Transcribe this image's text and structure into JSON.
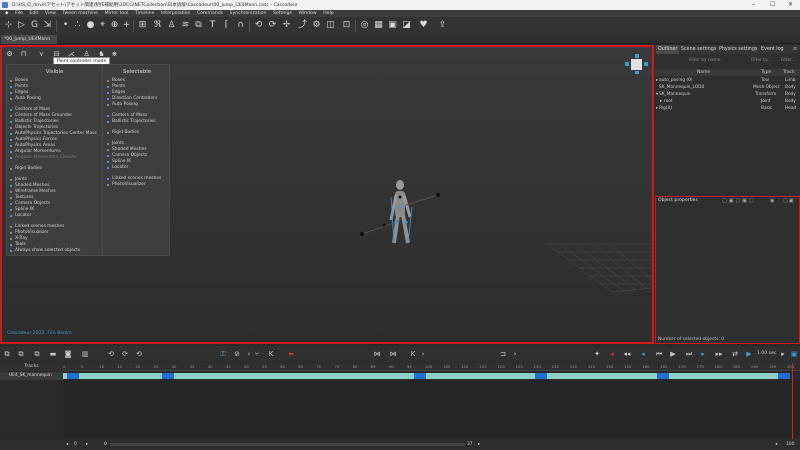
{
  "window": {
    "title": "D:\\HS_D_drive\\アセット\\アセット関連\\制作補助用\\3DCG\\NETCollection\\日本語版\\Cascadeur\\00_jump_UE4Mann.casc - Cascadeur"
  },
  "menu": [
    "File",
    "Edit",
    "View",
    "Tween machine",
    "Mirror tool",
    "Timeline",
    "Interpolation",
    "Commands",
    "Synchronization",
    "Settings",
    "Window",
    "Help"
  ],
  "doc_tab": "*00_jump_UE4Mann",
  "tooltip": "Point controller mode",
  "visible_panel": {
    "visible_title": "Visible",
    "selectable_title": "Selectable",
    "visible_items": [
      {
        "label": "Boxes",
        "on": false
      },
      {
        "label": "Points",
        "on": true
      },
      {
        "label": "Edges",
        "on": true
      },
      {
        "label": "Auto Posing",
        "on": false
      },
      {
        "gap": true
      },
      {
        "label": "Centers of Mass",
        "on": true
      },
      {
        "label": "Centers of Mass Grounder",
        "on": false
      },
      {
        "label": "Ballistic Trajectories",
        "on": true
      },
      {
        "label": "Objects Trajectories",
        "on": false
      },
      {
        "label": "AutoPhysics Trajectories Center Mass",
        "on": true
      },
      {
        "label": "AutoPhysics Forces",
        "on": true
      },
      {
        "label": "AutoPhysics Areas",
        "on": true
      },
      {
        "label": "Angular Momentums",
        "on": true
      },
      {
        "label": "Angular Momentum Circuits",
        "on": false,
        "dim": true
      },
      {
        "gap": true
      },
      {
        "label": "Rigid Bodies",
        "on": false
      },
      {
        "gap": true
      },
      {
        "label": "Joints",
        "on": false
      },
      {
        "label": "Shaded Meshes",
        "on": true
      },
      {
        "label": "Wireframe Meshes",
        "on": false
      },
      {
        "label": "Textures",
        "on": false
      },
      {
        "label": "Camera Objects",
        "on": true
      },
      {
        "label": "Spline IK",
        "on": true
      },
      {
        "label": "Locator",
        "on": true
      },
      {
        "gap": true
      },
      {
        "label": "Linked scenes meshes",
        "on": false
      },
      {
        "label": "PhotoVisualizer",
        "on": false
      },
      {
        "label": "X-Ray",
        "on": false
      },
      {
        "label": "Tools",
        "on": true
      },
      {
        "label": "Always show selected objects",
        "on": true
      }
    ],
    "selectable_items": [
      {
        "label": "Boxes",
        "on": false
      },
      {
        "label": "Points",
        "on": true
      },
      {
        "label": "Edges",
        "on": true
      },
      {
        "label": "Direction Controllers",
        "on": true
      },
      {
        "label": "Auto Posing",
        "on": false
      },
      {
        "gap": true
      },
      {
        "label": "Centers of Mass",
        "on": true
      },
      {
        "label": "Ballistic Trajectories",
        "on": true
      },
      {
        "gap": true
      },
      {
        "label": "Rigid Bodies",
        "on": false
      },
      {
        "gap": true
      },
      {
        "label": "Joints",
        "on": false
      },
      {
        "label": "Shaded Meshes",
        "on": false
      },
      {
        "label": "Camera Objects",
        "on": true
      },
      {
        "label": "Spline IK",
        "on": true
      },
      {
        "label": "Locator",
        "on": true
      },
      {
        "gap": true
      },
      {
        "label": "Linked scenes meshes",
        "on": true
      },
      {
        "label": "PhotoVisualizer",
        "on": false
      }
    ]
  },
  "copyright": "Cascadeur 2022, Tim Bloom",
  "right_tabs": [
    "Outliner",
    "Scene settings",
    "Physics settings",
    "Event log"
  ],
  "outliner": {
    "filter_placeholder": "Filter by name",
    "filter2": "Filter ty...",
    "filter3": "Filter...",
    "columns": [
      "Name",
      "Type",
      "Track"
    ],
    "rows": [
      {
        "name": "auto_posing (0)",
        "type": "Tool",
        "track": "Limb"
      },
      {
        "name": "SK_Mannequin_LOD0",
        "type": "Mesh Object",
        "track": "Body"
      },
      {
        "name": "SK_Mannequin",
        "type": "Transform",
        "track": "Body"
      },
      {
        "name": "root",
        "type": "Joint",
        "track": "Body"
      },
      {
        "name": "Rig(0)",
        "type": "Basic",
        "track": "Head"
      }
    ]
  },
  "object_properties": {
    "title": "Object properties",
    "footer": "Number of selected objects: 0"
  },
  "timeline": {
    "tracks_header": "Tracks",
    "track_name": "UE4_SK_mannequin",
    "ruler_ticks": [
      "0",
      "5",
      "10",
      "15",
      "20",
      "25",
      "30",
      "35",
      "40",
      "45",
      "50",
      "55",
      "60",
      "65",
      "70",
      "75",
      "80",
      "85",
      "90",
      "95",
      "100",
      "105",
      "110",
      "115",
      "120",
      "125",
      "130",
      "135",
      "140",
      "145",
      "150",
      "155",
      "160",
      "165",
      "170",
      "175",
      "180",
      "185",
      "190",
      "195",
      "200"
    ],
    "speed": "1.00 sec",
    "frame_start": "0",
    "frame_current": "0",
    "frame_mid": "37",
    "frame_end": "100",
    "track_color": "#8fd1c9",
    "key_color": "#1f6fd0"
  },
  "colors": {
    "highlight": "#d01818",
    "accent": "#3d9bd6"
  }
}
